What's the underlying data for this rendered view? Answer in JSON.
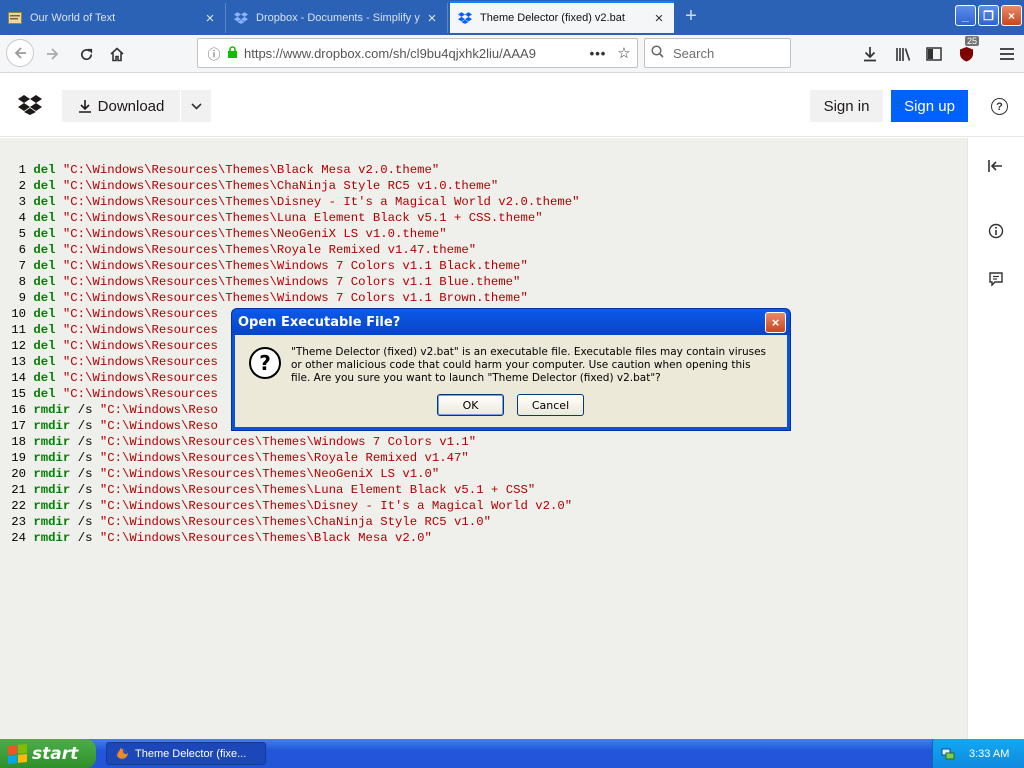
{
  "tabs": [
    {
      "title": "Our World of Text",
      "active": false
    },
    {
      "title": "Dropbox - Documents - Simplify y",
      "active": false
    },
    {
      "title": "Theme Delector (fixed) v2.bat",
      "active": true
    }
  ],
  "nav": {
    "url": "https://www.dropbox.com/sh/cl9bu4qjxhk2liu/AAA9",
    "search_placeholder": "Search",
    "ublock_badge": "25"
  },
  "dropbox": {
    "download_label": "Download",
    "signin_label": "Sign in",
    "signup_label": "Sign up",
    "help_label": "?"
  },
  "code_lines": [
    {
      "num": "1",
      "kw": "del",
      "sw": "",
      "path": "\"C:\\Windows\\Resources\\Themes\\Black Mesa v2.0.theme\""
    },
    {
      "num": "2",
      "kw": "del",
      "sw": "",
      "path": "\"C:\\Windows\\Resources\\Themes\\ChaNinja Style RC5 v1.0.theme\""
    },
    {
      "num": "3",
      "kw": "del",
      "sw": "",
      "path": "\"C:\\Windows\\Resources\\Themes\\Disney - It's a Magical World v2.0.theme\""
    },
    {
      "num": "4",
      "kw": "del",
      "sw": "",
      "path": "\"C:\\Windows\\Resources\\Themes\\Luna Element Black v5.1 + CSS.theme\""
    },
    {
      "num": "5",
      "kw": "del",
      "sw": "",
      "path": "\"C:\\Windows\\Resources\\Themes\\NeoGeniX LS v1.0.theme\""
    },
    {
      "num": "6",
      "kw": "del",
      "sw": "",
      "path": "\"C:\\Windows\\Resources\\Themes\\Royale Remixed v1.47.theme\""
    },
    {
      "num": "7",
      "kw": "del",
      "sw": "",
      "path": "\"C:\\Windows\\Resources\\Themes\\Windows 7 Colors v1.1 Black.theme\""
    },
    {
      "num": "8",
      "kw": "del",
      "sw": "",
      "path": "\"C:\\Windows\\Resources\\Themes\\Windows 7 Colors v1.1 Blue.theme\""
    },
    {
      "num": "9",
      "kw": "del",
      "sw": "",
      "path": "\"C:\\Windows\\Resources\\Themes\\Windows 7 Colors v1.1 Brown.theme\""
    },
    {
      "num": "10",
      "kw": "del",
      "sw": "",
      "path": "\"C:\\Windows\\Resources"
    },
    {
      "num": "11",
      "kw": "del",
      "sw": "",
      "path": "\"C:\\Windows\\Resources"
    },
    {
      "num": "12",
      "kw": "del",
      "sw": "",
      "path": "\"C:\\Windows\\Resources"
    },
    {
      "num": "13",
      "kw": "del",
      "sw": "",
      "path": "\"C:\\Windows\\Resources"
    },
    {
      "num": "14",
      "kw": "del",
      "sw": "",
      "path": "\"C:\\Windows\\Resources"
    },
    {
      "num": "15",
      "kw": "del",
      "sw": "",
      "path": "\"C:\\Windows\\Resources"
    },
    {
      "num": "16",
      "kw": "rmdir",
      "sw": "/s",
      "path": "\"C:\\Windows\\Reso"
    },
    {
      "num": "17",
      "kw": "rmdir",
      "sw": "/s",
      "path": "\"C:\\Windows\\Reso"
    },
    {
      "num": "18",
      "kw": "rmdir",
      "sw": "/s",
      "path": "\"C:\\Windows\\Resources\\Themes\\Windows 7 Colors v1.1\""
    },
    {
      "num": "19",
      "kw": "rmdir",
      "sw": "/s",
      "path": "\"C:\\Windows\\Resources\\Themes\\Royale Remixed v1.47\""
    },
    {
      "num": "20",
      "kw": "rmdir",
      "sw": "/s",
      "path": "\"C:\\Windows\\Resources\\Themes\\NeoGeniX LS v1.0\""
    },
    {
      "num": "21",
      "kw": "rmdir",
      "sw": "/s",
      "path": "\"C:\\Windows\\Resources\\Themes\\Luna Element Black v5.1 + CSS\""
    },
    {
      "num": "22",
      "kw": "rmdir",
      "sw": "/s",
      "path": "\"C:\\Windows\\Resources\\Themes\\Disney - It's a Magical World v2.0\""
    },
    {
      "num": "23",
      "kw": "rmdir",
      "sw": "/s",
      "path": "\"C:\\Windows\\Resources\\Themes\\ChaNinja Style RC5 v1.0\""
    },
    {
      "num": "24",
      "kw": "rmdir",
      "sw": "/s",
      "path": "\"C:\\Windows\\Resources\\Themes\\Black Mesa v2.0\""
    }
  ],
  "dialog": {
    "title": "Open Executable File?",
    "message": "\"Theme Delector (fixed) v2.bat\" is an executable file. Executable files may contain viruses or other malicious code that could harm your computer. Use caution when opening this file. Are you sure you want to launch \"Theme Delector (fixed) v2.bat\"?",
    "ok_label": "OK",
    "cancel_label": "Cancel"
  },
  "taskbar": {
    "start_label": "start",
    "task_item": "Theme Delector (fixe...",
    "clock": "3:33 AM"
  },
  "colors": {
    "keyword": "#007f00",
    "string": "#b00000",
    "signup_bg": "#0061fe"
  }
}
